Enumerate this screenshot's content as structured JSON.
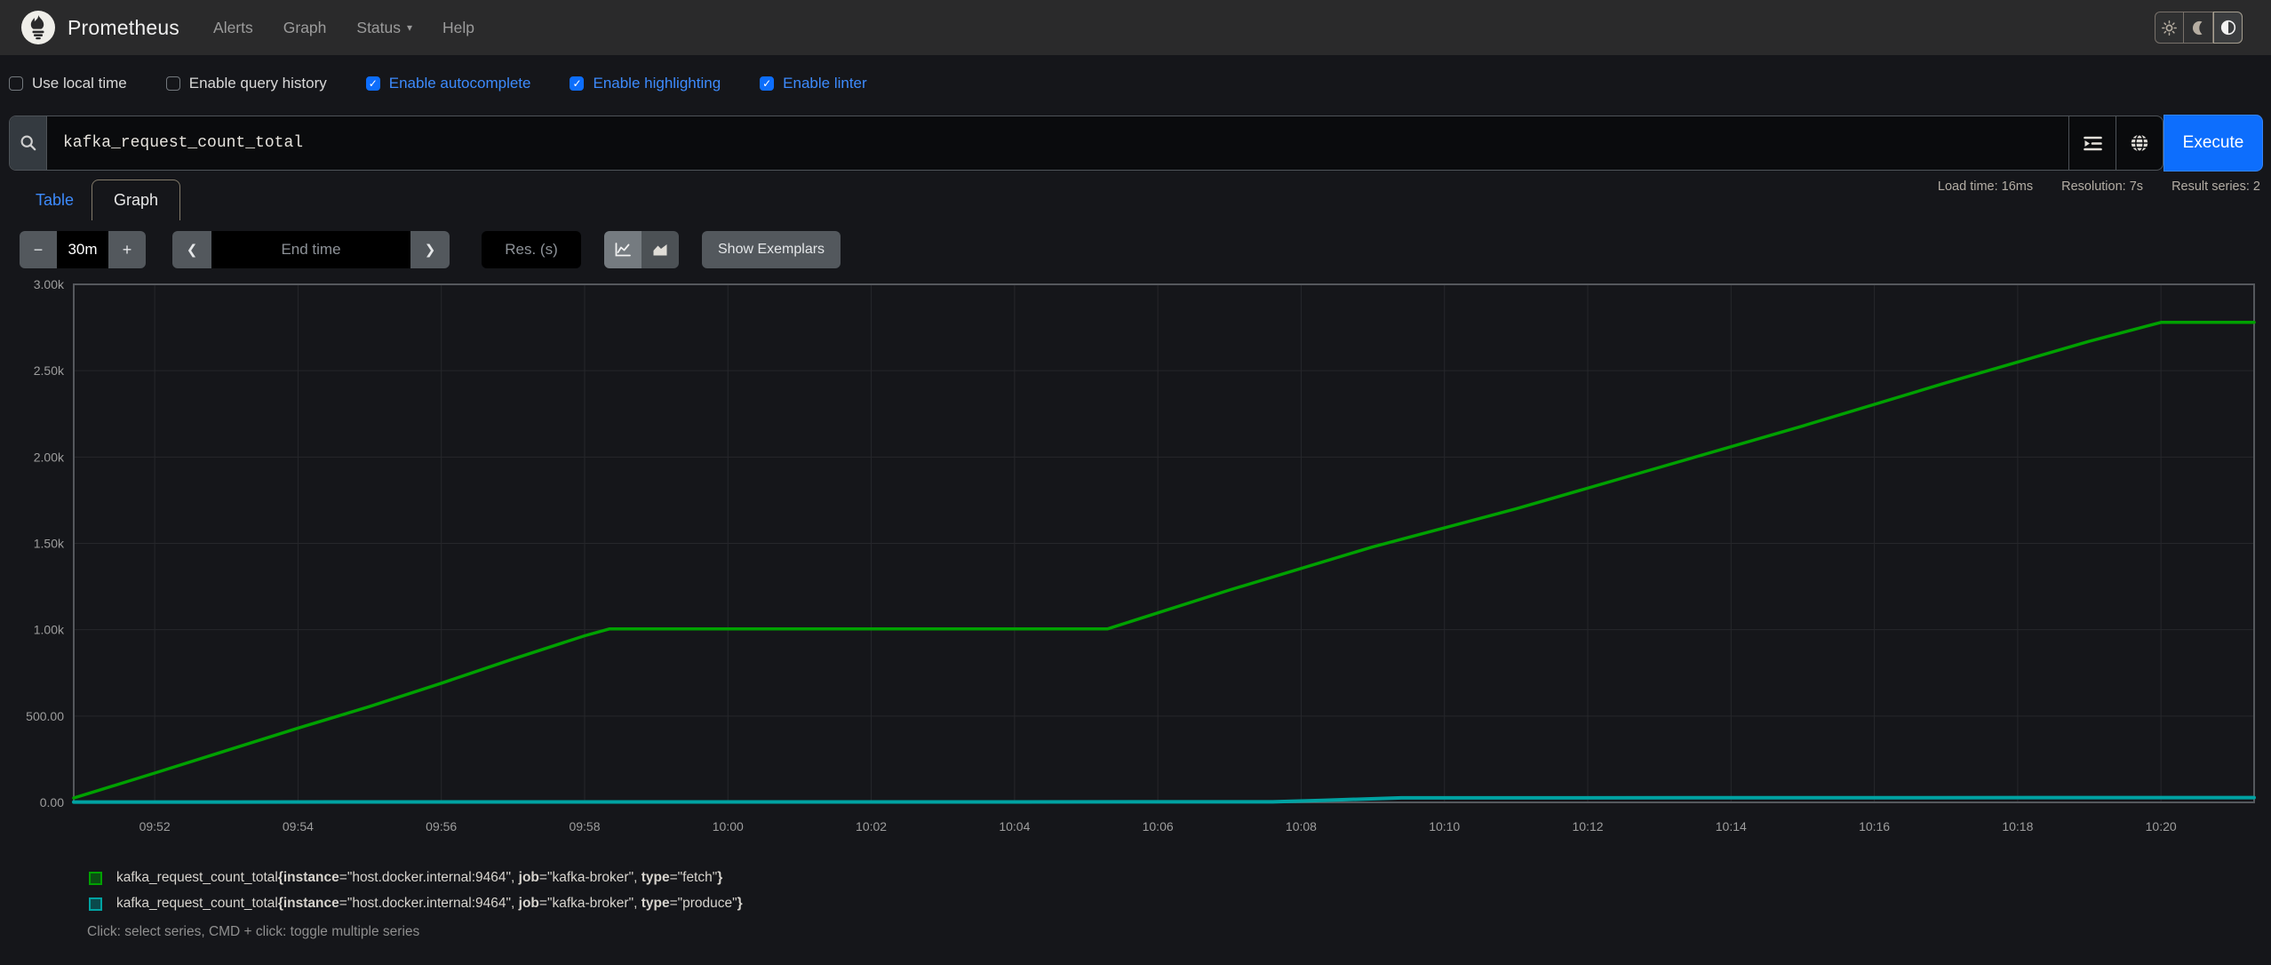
{
  "navbar": {
    "brand": "Prometheus",
    "links": [
      {
        "label": "Alerts"
      },
      {
        "label": "Graph"
      },
      {
        "label": "Status",
        "has_caret": true
      },
      {
        "label": "Help"
      }
    ],
    "theme_toggle": {
      "buttons": [
        {
          "name": "light",
          "icon": "sun-icon",
          "active": false
        },
        {
          "name": "dark",
          "icon": "moon-icon",
          "active": false
        },
        {
          "name": "auto",
          "icon": "auto-contrast-icon",
          "active": true
        }
      ]
    }
  },
  "options": {
    "checkboxes": [
      {
        "label": "Use local time",
        "checked": false
      },
      {
        "label": "Enable query history",
        "checked": false
      },
      {
        "label": "Enable autocomplete",
        "checked": true
      },
      {
        "label": "Enable highlighting",
        "checked": true
      },
      {
        "label": "Enable linter",
        "checked": true
      }
    ]
  },
  "query": {
    "value": "kafka_request_count_total",
    "execute_label": "Execute"
  },
  "result_stats": {
    "load_time": "Load time: 16ms",
    "resolution": "Resolution: 7s",
    "result_series": "Result series: 2"
  },
  "tabs": [
    {
      "label": "Table",
      "active": false
    },
    {
      "label": "Graph",
      "active": true
    }
  ],
  "graph_controls": {
    "decrease_label": "−",
    "range_value": "30m",
    "increase_label": "+",
    "back_label": "❮",
    "end_time_placeholder": "End time",
    "forward_label": "❯",
    "resolution_placeholder": "Res. (s)",
    "show_exemplars_label": "Show Exemplars"
  },
  "chart_data": {
    "type": "line",
    "x_axis": "time",
    "x_unit": "minutes_after_09:50",
    "xlim_minutes": [
      0.87,
      31.3
    ],
    "ylim": [
      0,
      3000
    ],
    "grid": true,
    "legend_position": "bottom",
    "colors": {
      "grid": "#26272b",
      "border": "#55585d",
      "ticks": "#9d9d9d"
    },
    "yticks": [
      {
        "v": 0,
        "label": "0.00"
      },
      {
        "v": 500,
        "label": "500.00"
      },
      {
        "v": 1000,
        "label": "1.00k"
      },
      {
        "v": 1500,
        "label": "1.50k"
      },
      {
        "v": 2000,
        "label": "2.00k"
      },
      {
        "v": 2500,
        "label": "2.50k"
      },
      {
        "v": 3000,
        "label": "3.00k"
      }
    ],
    "xticks": [
      {
        "v": 2,
        "label": "09:52"
      },
      {
        "v": 4,
        "label": "09:54"
      },
      {
        "v": 6,
        "label": "09:56"
      },
      {
        "v": 8,
        "label": "09:58"
      },
      {
        "v": 10,
        "label": "10:00"
      },
      {
        "v": 12,
        "label": "10:02"
      },
      {
        "v": 14,
        "label": "10:04"
      },
      {
        "v": 16,
        "label": "10:06"
      },
      {
        "v": 18,
        "label": "10:08"
      },
      {
        "v": 20,
        "label": "10:10"
      },
      {
        "v": 22,
        "label": "10:12"
      },
      {
        "v": 24,
        "label": "10:14"
      },
      {
        "v": 26,
        "label": "10:16"
      },
      {
        "v": 28,
        "label": "10:18"
      },
      {
        "v": 30,
        "label": "10:20"
      }
    ],
    "series": [
      {
        "name": "kafka_request_count_total{type=\"fetch\"}",
        "color": "#00a100",
        "width": 3.5,
        "points": [
          [
            0.87,
            25
          ],
          [
            2,
            170
          ],
          [
            3,
            300
          ],
          [
            4,
            430
          ],
          [
            5,
            555
          ],
          [
            6,
            690
          ],
          [
            7,
            830
          ],
          [
            8,
            965
          ],
          [
            8.35,
            1005
          ],
          [
            15.3,
            1005
          ],
          [
            17,
            1230
          ],
          [
            19,
            1480
          ],
          [
            21,
            1700
          ],
          [
            23,
            1940
          ],
          [
            25,
            2180
          ],
          [
            27,
            2430
          ],
          [
            29,
            2670
          ],
          [
            30,
            2780
          ],
          [
            31.3,
            2780
          ]
        ]
      },
      {
        "name": "kafka_request_count_total{type=\"produce\"}",
        "color": "#00a2a2",
        "width": 4,
        "points": [
          [
            0.87,
            2
          ],
          [
            17.6,
            3
          ],
          [
            18.3,
            12
          ],
          [
            19.4,
            26
          ],
          [
            31.3,
            28
          ]
        ]
      }
    ]
  },
  "legend": {
    "entries": [
      {
        "color": "#00a100",
        "swatch_fill": "#0a4f12",
        "metric": "kafka_request_count_total",
        "labels": [
          {
            "name": "instance",
            "value": "host.docker.internal:9464"
          },
          {
            "name": "job",
            "value": "kafka-broker"
          },
          {
            "name": "type",
            "value": "fetch"
          }
        ]
      },
      {
        "color": "#00a2a2",
        "swatch_fill": "#0a4a4c",
        "metric": "kafka_request_count_total",
        "labels": [
          {
            "name": "instance",
            "value": "host.docker.internal:9464"
          },
          {
            "name": "job",
            "value": "kafka-broker"
          },
          {
            "name": "type",
            "value": "produce"
          }
        ]
      }
    ],
    "hint": "Click: select series, CMD + click: toggle multiple series"
  }
}
